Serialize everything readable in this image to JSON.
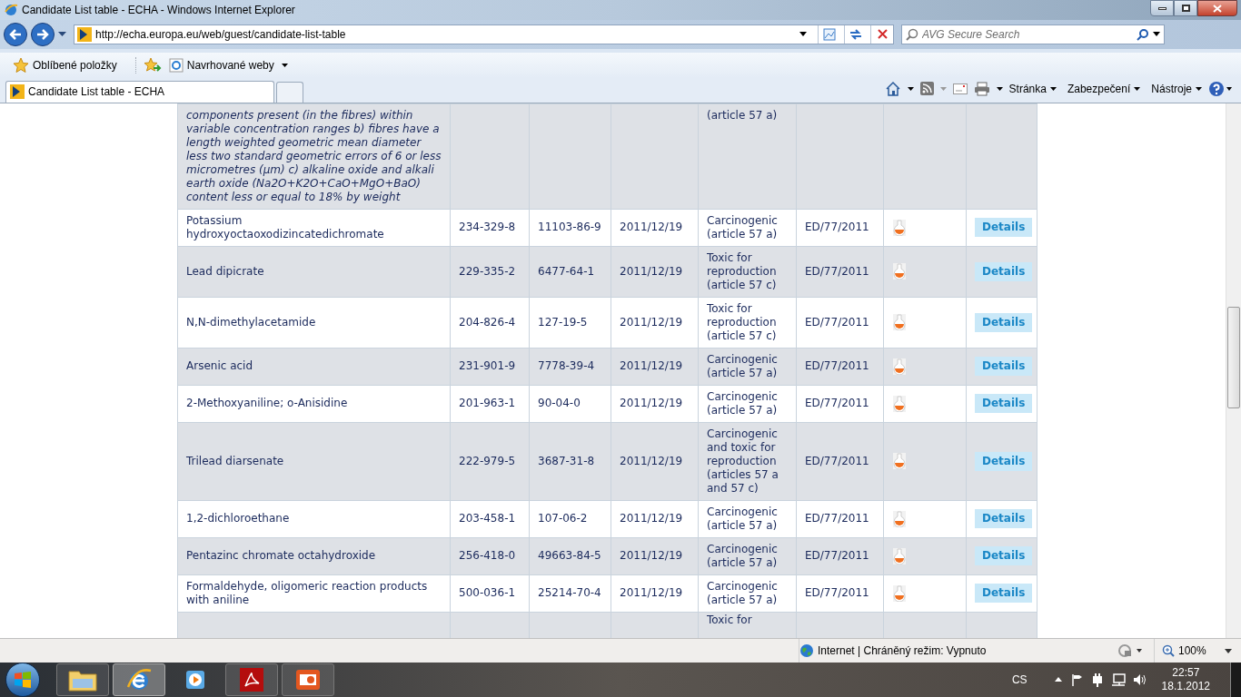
{
  "window": {
    "title": "Candidate List table - ECHA - Windows Internet Explorer"
  },
  "address_bar": {
    "url": "http://echa.europa.eu/web/guest/candidate-list-table"
  },
  "search": {
    "placeholder": "AVG Secure Search"
  },
  "favorites_bar": {
    "favorites": "Oblíbené položky",
    "suggested": "Navrhované weby"
  },
  "tabs": [
    {
      "label": "Candidate List table - ECHA",
      "selected": true
    }
  ],
  "command_bar": [
    "Stránka",
    "Zabezpečení",
    "Nástroje"
  ],
  "table": {
    "rows": [
      {
        "name": "components present (in the fibres) within variable concentration ranges b) fibres have a length weighted geometric mean diameter less two standard geometric errors of 6 or less micrometres (µm) c) alkaline oxide and alkali earth oxide (Na2O+K2O+CaO+MgO+BaO) content less or equal to 18% by weight",
        "name_italic": true,
        "reason": "(article 57 a)",
        "kind": "cut-top"
      },
      {
        "name": "Potassium hydroxyoctaoxodizincatedichromate",
        "ec": "234-329-8",
        "cas": "11103-86-9",
        "date": "2011/12/19",
        "reason": "Carcinogenic (article 57 a)",
        "decision": "ED/77/2011",
        "button": "Details",
        "kind": "full"
      },
      {
        "name": "Lead dipicrate",
        "ec": "229-335-2",
        "cas": "6477-64-1",
        "date": "2011/12/19",
        "reason": "Toxic for reproduction (article 57 c)",
        "decision": "ED/77/2011",
        "button": "Details",
        "kind": "full"
      },
      {
        "name": "N,N-dimethylacetamide",
        "ec": "204-826-4",
        "cas": "127-19-5",
        "date": "2011/12/19",
        "reason": "Toxic for reproduction (article 57 c)",
        "decision": "ED/77/2011",
        "button": "Details",
        "kind": "full"
      },
      {
        "name": "Arsenic acid",
        "ec": "231-901-9",
        "cas": "7778-39-4",
        "date": "2011/12/19",
        "reason": "Carcinogenic (article 57 a)",
        "decision": "ED/77/2011",
        "button": "Details",
        "kind": "full"
      },
      {
        "name": "2-Methoxyaniline; o-Anisidine",
        "ec": "201-963-1",
        "cas": "90-04-0",
        "date": "2011/12/19",
        "reason": "Carcinogenic (article 57 a)",
        "decision": "ED/77/2011",
        "button": "Details",
        "kind": "full"
      },
      {
        "name": "Trilead diarsenate",
        "ec": "222-979-5",
        "cas": "3687-31-8",
        "date": "2011/12/19",
        "reason": "Carcinogenic and toxic for reproduction (articles 57 a and 57 c)",
        "decision": "ED/77/2011",
        "button": "Details",
        "kind": "full"
      },
      {
        "name": "1,2-dichloroethane",
        "ec": "203-458-1",
        "cas": "107-06-2",
        "date": "2011/12/19",
        "reason": "Carcinogenic (article 57 a)",
        "decision": "ED/77/2011",
        "button": "Details",
        "kind": "full"
      },
      {
        "name": "Pentazinc chromate octahydroxide",
        "ec": "256-418-0",
        "cas": "49663-84-5",
        "date": "2011/12/19",
        "reason": "Carcinogenic (article 57 a)",
        "decision": "ED/77/2011",
        "button": "Details",
        "kind": "full"
      },
      {
        "name": "Formaldehyde, oligomeric reaction products with aniline",
        "ec": "500-036-1",
        "cas": "25214-70-4",
        "date": "2011/12/19",
        "reason": "Carcinogenic (article 57 a)",
        "decision": "ED/77/2011",
        "button": "Details",
        "kind": "full"
      },
      {
        "reason": "Toxic for",
        "kind": "cut-bottom"
      }
    ]
  },
  "status_bar": {
    "zone": "Internet | Chráněný režim: Vypnuto",
    "zoom": "100%"
  },
  "tray": {
    "language": "CS",
    "time": "22:57",
    "date": "18.1.2012"
  }
}
